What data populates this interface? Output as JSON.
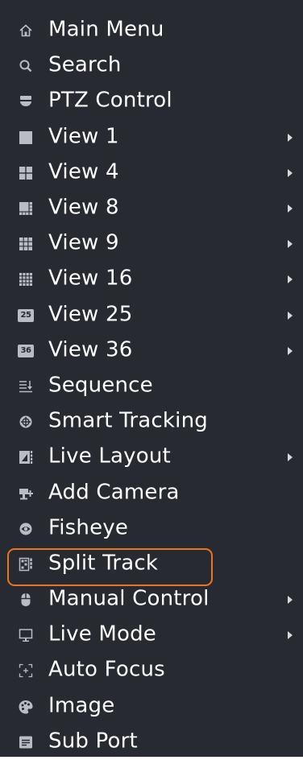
{
  "menu": {
    "items": [
      {
        "label": "Main Menu",
        "icon": "home-icon",
        "submenu": false
      },
      {
        "label": "Search",
        "icon": "search-icon",
        "submenu": false
      },
      {
        "label": "PTZ Control",
        "icon": "ptz-camera-icon",
        "submenu": false
      },
      {
        "label": "View 1",
        "icon": "view-1-icon",
        "submenu": true
      },
      {
        "label": "View 4",
        "icon": "view-4-icon",
        "submenu": true
      },
      {
        "label": "View 8",
        "icon": "view-8-icon",
        "submenu": true
      },
      {
        "label": "View 9",
        "icon": "view-9-icon",
        "submenu": true
      },
      {
        "label": "View 16",
        "icon": "view-16-icon",
        "submenu": true
      },
      {
        "label": "View 25",
        "icon": "view-25-icon",
        "badge": "25",
        "submenu": true
      },
      {
        "label": "View 36",
        "icon": "view-36-icon",
        "badge": "36",
        "submenu": true
      },
      {
        "label": "Sequence",
        "icon": "sequence-icon",
        "submenu": false
      },
      {
        "label": "Smart Tracking",
        "icon": "smart-tracking-icon",
        "submenu": false
      },
      {
        "label": "Live Layout",
        "icon": "live-layout-icon",
        "submenu": true
      },
      {
        "label": "Add Camera",
        "icon": "add-camera-icon",
        "submenu": false
      },
      {
        "label": "Fisheye",
        "icon": "fisheye-icon",
        "submenu": false
      },
      {
        "label": "Split Track",
        "icon": "split-track-icon",
        "submenu": false,
        "highlighted": true
      },
      {
        "label": "Manual Control",
        "icon": "manual-control-icon",
        "submenu": true
      },
      {
        "label": "Live Mode",
        "icon": "live-mode-icon",
        "submenu": true
      },
      {
        "label": "Auto Focus",
        "icon": "auto-focus-icon",
        "submenu": false
      },
      {
        "label": "Image",
        "icon": "image-icon",
        "submenu": false
      },
      {
        "label": "Sub Port",
        "icon": "sub-port-icon",
        "submenu": false
      }
    ]
  },
  "colors": {
    "background": "#272a31",
    "text": "#ffffff",
    "icon": "#b9bcc2",
    "arrow": "#d8d8d8",
    "highlight_border": "#e8742a"
  }
}
